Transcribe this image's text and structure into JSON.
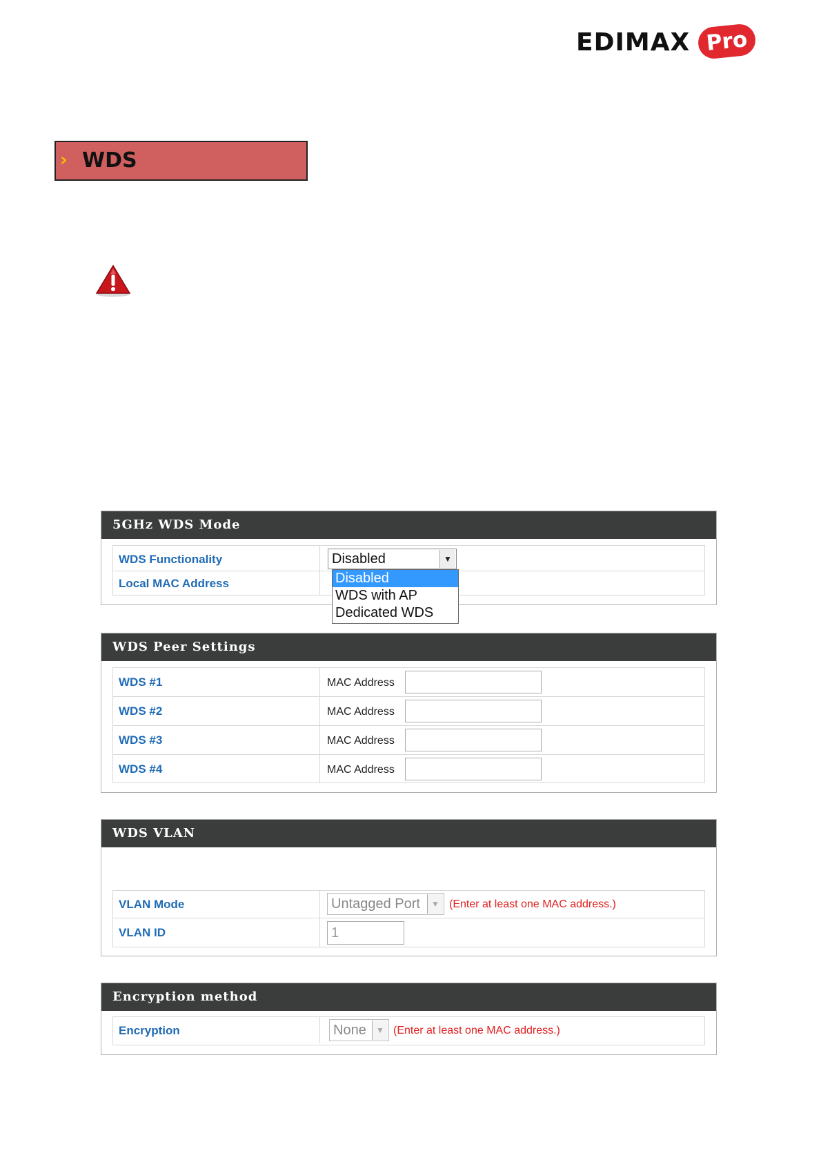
{
  "logo": {
    "brand": "EDIMAX",
    "pro": "Pro"
  },
  "banner": {
    "arrow": "›",
    "title": "WDS"
  },
  "icons": {
    "warning": "warning-triangle-icon",
    "dropdown_arrow": "chevron-down-icon"
  },
  "colors": {
    "banner_bg": "#d06060",
    "header_bg": "#3b3d3d",
    "label_blue": "#1f6bb5",
    "hint_red": "#e02020",
    "selected_option": "#3399ff"
  },
  "wds_mode": {
    "header": "5GHz WDS Mode",
    "functionality_label": "WDS Functionality",
    "functionality_value": "Disabled",
    "local_mac_label": "Local MAC Address",
    "dropdown_options": [
      "Disabled",
      "WDS with AP",
      "Dedicated WDS"
    ],
    "selected_index": 0
  },
  "peer": {
    "header": "WDS Peer Settings",
    "mac_label": "MAC Address",
    "rows": [
      {
        "label": "WDS #1",
        "value": ""
      },
      {
        "label": "WDS #2",
        "value": ""
      },
      {
        "label": "WDS #3",
        "value": ""
      },
      {
        "label": "WDS #4",
        "value": ""
      }
    ]
  },
  "vlan": {
    "header": "WDS VLAN",
    "mode_label": "VLAN Mode",
    "mode_value": "Untagged Port",
    "mode_hint": "(Enter at least one MAC address.)",
    "id_label": "VLAN ID",
    "id_value": "1"
  },
  "encryption": {
    "header": "Encryption method",
    "label": "Encryption",
    "value": "None",
    "hint": "(Enter at least one MAC address.)"
  }
}
